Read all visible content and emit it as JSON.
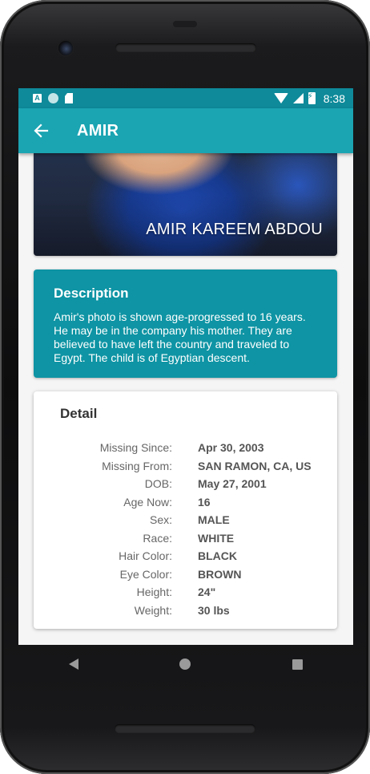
{
  "status_bar": {
    "time": "8:38",
    "icons": [
      "a-notification-icon",
      "circle-notification-icon",
      "sd-card-icon",
      "wifi-icon",
      "cell-signal-icon",
      "battery-charging-icon"
    ]
  },
  "app_bar": {
    "back_icon": "arrow-left-icon",
    "title": "AMIR"
  },
  "photo": {
    "caption": "AMIR KAREEM ABDOU"
  },
  "description": {
    "title": "Description",
    "text": "Amir's photo is shown age-progressed to 16 years.\nHe may be in the company his mother.  They are\nbelieved to have left the country and traveled to\nEgypt.  The child is of Egyptian descent."
  },
  "detail": {
    "title": "Detail",
    "rows": [
      {
        "label": "Missing Since:",
        "value": "Apr 30, 2003"
      },
      {
        "label": "Missing From:",
        "value": "SAN RAMON, CA, US"
      },
      {
        "label": "DOB:",
        "value": "May 27, 2001"
      },
      {
        "label": "Age Now:",
        "value": "16"
      },
      {
        "label": "Sex:",
        "value": "MALE"
      },
      {
        "label": "Race:",
        "value": "WHITE"
      },
      {
        "label": "Hair Color:",
        "value": "BLACK"
      },
      {
        "label": "Eye Color:",
        "value": "BROWN"
      },
      {
        "label": "Height:",
        "value": "24\""
      },
      {
        "label": "Weight:",
        "value": "30 lbs"
      }
    ]
  },
  "nav_bar": {
    "buttons": [
      "back-triangle-icon",
      "home-circle-icon",
      "recents-square-icon"
    ]
  },
  "colors": {
    "status_bar": "#0e8a9a",
    "app_bar": "#1ba4b2",
    "description_card": "#0e94a4"
  }
}
